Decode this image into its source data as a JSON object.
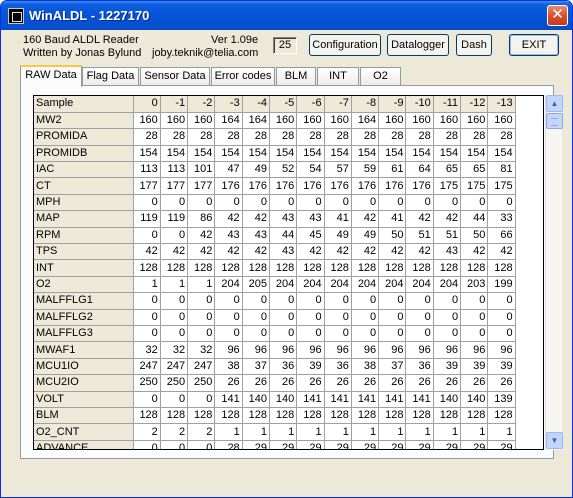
{
  "window": {
    "title": "WinALDL - 1227170",
    "close": "✕"
  },
  "header": {
    "app_line1": "160 Baud ALDL Reader",
    "app_line2": "Written by Jonas Bylund",
    "version": "Ver 1.09e",
    "email": "joby.teknik@telia.com",
    "counter": "25"
  },
  "buttons": {
    "configuration": "Configuration",
    "datalogger": "Datalogger",
    "dash": "Dash",
    "exit": "EXIT"
  },
  "tabs": [
    "RAW Data",
    "Flag Data",
    "Sensor Data",
    "Error codes",
    "BLM",
    "INT",
    "O2"
  ],
  "grid": {
    "header_label": "Sample",
    "columns": [
      "0",
      "-1",
      "-2",
      "-3",
      "-4",
      "-5",
      "-6",
      "-7",
      "-8",
      "-9",
      "-10",
      "-11",
      "-12",
      "-13"
    ],
    "rows": [
      {
        "name": "MW2",
        "values": [
          "160",
          "160",
          "160",
          "164",
          "164",
          "160",
          "160",
          "160",
          "164",
          "160",
          "160",
          "160",
          "160",
          "160"
        ]
      },
      {
        "name": "PROMIDA",
        "values": [
          "28",
          "28",
          "28",
          "28",
          "28",
          "28",
          "28",
          "28",
          "28",
          "28",
          "28",
          "28",
          "28",
          "28"
        ]
      },
      {
        "name": "PROMIDB",
        "values": [
          "154",
          "154",
          "154",
          "154",
          "154",
          "154",
          "154",
          "154",
          "154",
          "154",
          "154",
          "154",
          "154",
          "154"
        ]
      },
      {
        "name": "IAC",
        "values": [
          "113",
          "113",
          "101",
          "47",
          "49",
          "52",
          "54",
          "57",
          "59",
          "61",
          "64",
          "65",
          "65",
          "81"
        ]
      },
      {
        "name": "CT",
        "values": [
          "177",
          "177",
          "177",
          "176",
          "176",
          "176",
          "176",
          "176",
          "176",
          "176",
          "176",
          "175",
          "175",
          "175"
        ]
      },
      {
        "name": "MPH",
        "values": [
          "0",
          "0",
          "0",
          "0",
          "0",
          "0",
          "0",
          "0",
          "0",
          "0",
          "0",
          "0",
          "0",
          "0"
        ]
      },
      {
        "name": "MAP",
        "values": [
          "119",
          "119",
          "86",
          "42",
          "42",
          "43",
          "43",
          "41",
          "42",
          "41",
          "42",
          "42",
          "44",
          "33"
        ]
      },
      {
        "name": "RPM",
        "values": [
          "0",
          "0",
          "42",
          "43",
          "43",
          "44",
          "45",
          "49",
          "49",
          "50",
          "51",
          "51",
          "50",
          "66"
        ]
      },
      {
        "name": "TPS",
        "values": [
          "42",
          "42",
          "42",
          "42",
          "42",
          "43",
          "42",
          "42",
          "42",
          "42",
          "42",
          "43",
          "42",
          "42"
        ]
      },
      {
        "name": "INT",
        "values": [
          "128",
          "128",
          "128",
          "128",
          "128",
          "128",
          "128",
          "128",
          "128",
          "128",
          "128",
          "128",
          "128",
          "128"
        ]
      },
      {
        "name": "O2",
        "values": [
          "1",
          "1",
          "1",
          "204",
          "205",
          "204",
          "204",
          "204",
          "204",
          "204",
          "204",
          "204",
          "203",
          "199"
        ]
      },
      {
        "name": "MALFFLG1",
        "values": [
          "0",
          "0",
          "0",
          "0",
          "0",
          "0",
          "0",
          "0",
          "0",
          "0",
          "0",
          "0",
          "0",
          "0"
        ]
      },
      {
        "name": "MALFFLG2",
        "values": [
          "0",
          "0",
          "0",
          "0",
          "0",
          "0",
          "0",
          "0",
          "0",
          "0",
          "0",
          "0",
          "0",
          "0"
        ]
      },
      {
        "name": "MALFFLG3",
        "values": [
          "0",
          "0",
          "0",
          "0",
          "0",
          "0",
          "0",
          "0",
          "0",
          "0",
          "0",
          "0",
          "0",
          "0"
        ]
      },
      {
        "name": "MWAF1",
        "values": [
          "32",
          "32",
          "32",
          "96",
          "96",
          "96",
          "96",
          "96",
          "96",
          "96",
          "96",
          "96",
          "96",
          "96"
        ]
      },
      {
        "name": "MCU1IO",
        "values": [
          "247",
          "247",
          "247",
          "38",
          "37",
          "36",
          "39",
          "36",
          "38",
          "37",
          "36",
          "39",
          "39",
          "39"
        ]
      },
      {
        "name": "MCU2IO",
        "values": [
          "250",
          "250",
          "250",
          "26",
          "26",
          "26",
          "26",
          "26",
          "26",
          "26",
          "26",
          "26",
          "26",
          "26"
        ]
      },
      {
        "name": "VOLT",
        "values": [
          "0",
          "0",
          "0",
          "141",
          "140",
          "140",
          "141",
          "141",
          "141",
          "141",
          "141",
          "140",
          "140",
          "139"
        ]
      },
      {
        "name": "BLM",
        "values": [
          "128",
          "128",
          "128",
          "128",
          "128",
          "128",
          "128",
          "128",
          "128",
          "128",
          "128",
          "128",
          "128",
          "128"
        ]
      },
      {
        "name": "O2_CNT",
        "values": [
          "2",
          "2",
          "2",
          "1",
          "1",
          "1",
          "1",
          "1",
          "1",
          "1",
          "1",
          "1",
          "1",
          "1"
        ]
      },
      {
        "name": "ADVANCE",
        "values": [
          "0",
          "0",
          "0",
          "28",
          "29",
          "29",
          "29",
          "29",
          "29",
          "29",
          "29",
          "29",
          "29",
          "29"
        ]
      }
    ]
  },
  "scrollbar": {
    "up_icon": "up-arrow-icon",
    "down_icon": "down-arrow-icon"
  }
}
